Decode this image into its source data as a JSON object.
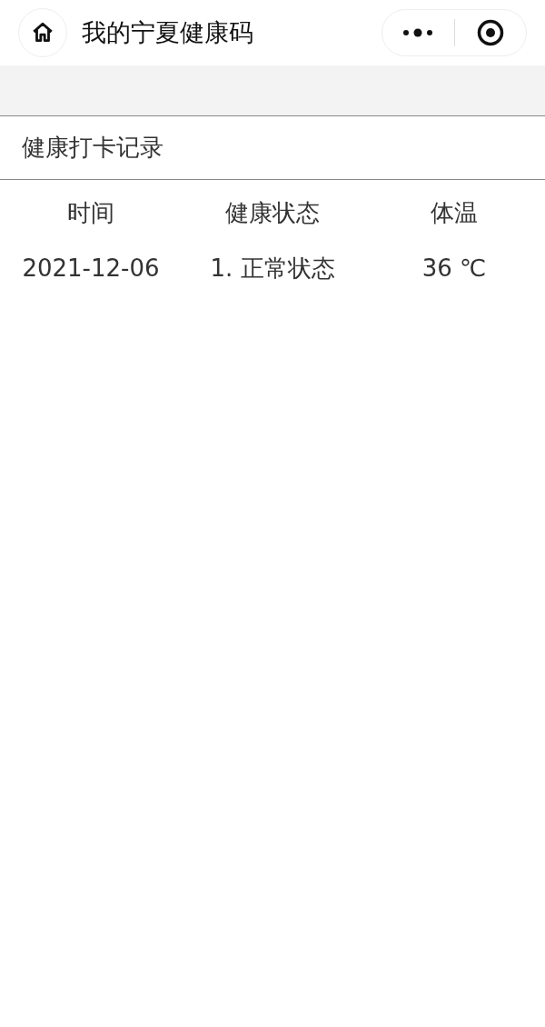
{
  "nav_bar": {
    "title": "我的宁夏健康码"
  },
  "section": {
    "title": "健康打卡记录"
  },
  "table": {
    "columns": [
      "时间",
      "健康状态",
      "体温"
    ],
    "rows": [
      [
        "2021-12-06",
        "1. 正常状态",
        "36 ℃"
      ]
    ]
  }
}
